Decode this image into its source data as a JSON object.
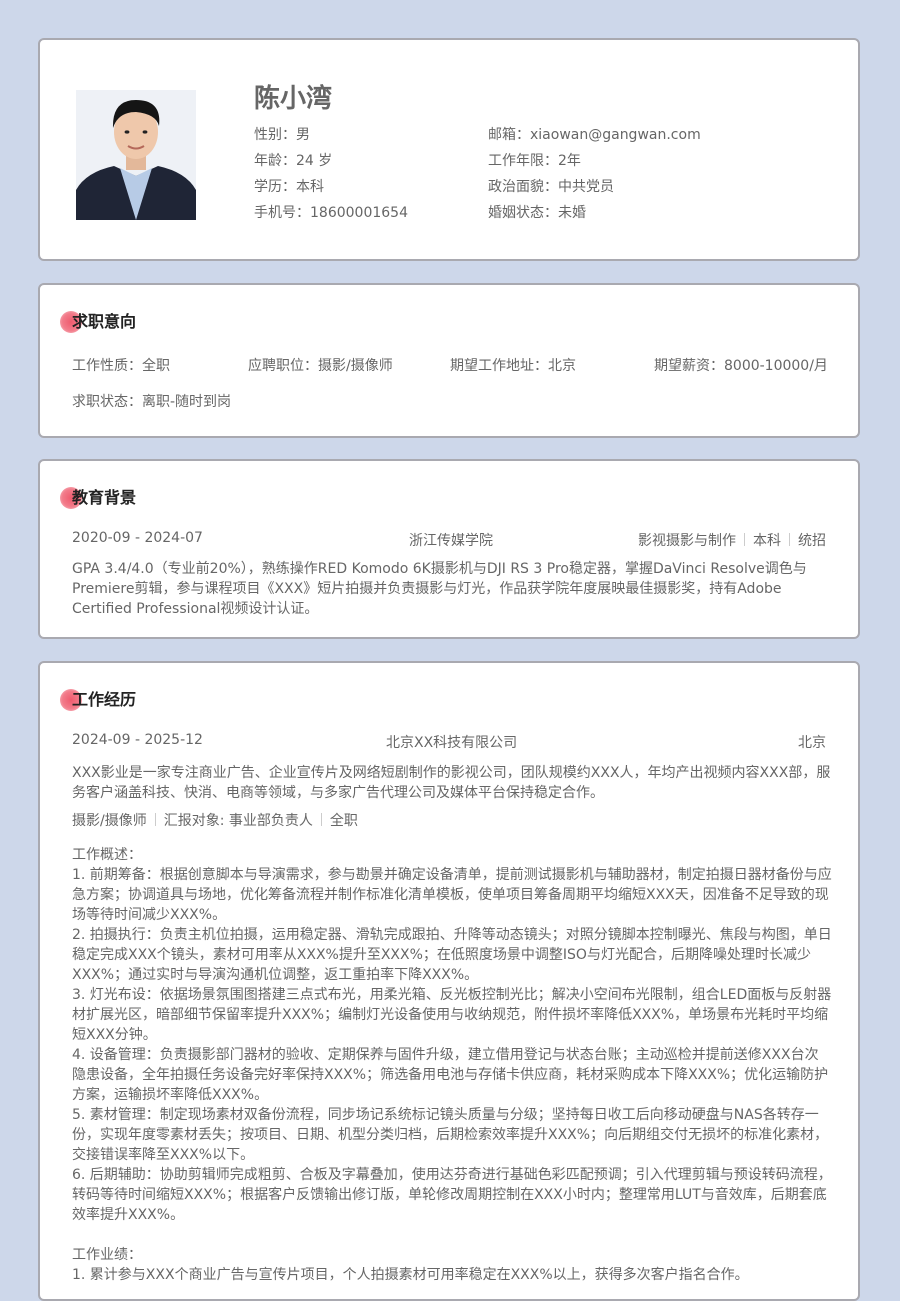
{
  "profile": {
    "name": "陈小湾",
    "gender_label": "性别：",
    "gender": "男",
    "age_label": "年龄：",
    "age": "24 岁",
    "education_label": "学历：",
    "education": "本科",
    "phone_label": "手机号：",
    "phone": "18600001654",
    "email_label": "邮箱：",
    "email": "xiaowan@gangwan.com",
    "years_label": "工作年限：",
    "years": "2年",
    "politics_label": "政治面貌：",
    "politics": "中共党员",
    "marital_label": "婚姻状态：",
    "marital": "未婚"
  },
  "intent": {
    "title": "求职意向",
    "type_label": "工作性质：",
    "type": "全职",
    "position_label": "应聘职位：",
    "position": "摄影/摄像师",
    "location_label": "期望工作地址：",
    "location": "北京",
    "salary_label": "期望薪资：",
    "salary": "8000-10000/月",
    "status_label": "求职状态：",
    "status": "离职-随时到岗"
  },
  "education": {
    "title": "教育背景",
    "period": "2020-09 - 2024-07",
    "school": "浙江传媒学院",
    "major": "影视摄影与制作",
    "degree": "本科",
    "enroll": "统招",
    "description": "GPA 3.4/4.0（专业前20%），熟练操作RED Komodo 6K摄影机与DJI RS 3 Pro稳定器，掌握DaVinci Resolve调色与Premiere剪辑，参与课程项目《XXX》短片拍摄并负责摄影与灯光，作品获学院年度展映最佳摄影奖，持有Adobe Certified Professional视频设计认证。"
  },
  "work": {
    "title": "工作经历",
    "period": "2024-09 - 2025-12",
    "company": "北京XX科技有限公司",
    "city": "北京",
    "company_intro": "XXX影业是一家专注商业广告、企业宣传片及网络短剧制作的影视公司，团队规模约XXX人，年均产出视频内容XXX部，服务客户涵盖科技、快消、电商等领域，与多家广告代理公司及媒体平台保持稳定合作。",
    "role": "摄影/摄像师",
    "report_to": "汇报对象: 事业部负责人",
    "employment": "全职",
    "overview_label": "工作概述：",
    "duties": [
      "1. 前期筹备：根据创意脚本与导演需求，参与勘景并确定设备清单，提前测试摄影机与辅助器材，制定拍摄日器材备份与应急方案；协调道具与场地，优化筹备流程并制作标准化清单模板，使单项目筹备周期平均缩短XXX天，因准备不足导致的现场等待时间减少XXX%。",
      "2. 拍摄执行：负责主机位拍摄，运用稳定器、滑轨完成跟拍、升降等动态镜头；对照分镜脚本控制曝光、焦段与构图，单日稳定完成XXX个镜头，素材可用率从XXX%提升至XXX%；在低照度场景中调整ISO与灯光配合，后期降噪处理时长减少XXX%；通过实时与导演沟通机位调整，返工重拍率下降XXX%。",
      "3. 灯光布设：依据场景氛围图搭建三点式布光，用柔光箱、反光板控制光比；解决小空间布光限制，组合LED面板与反射器材扩展光区，暗部细节保留率提升XXX%；编制灯光设备使用与收纳规范，附件损坏率降低XXX%，单场景布光耗时平均缩短XXX分钟。",
      "4. 设备管理：负责摄影部门器材的验收、定期保养与固件升级，建立借用登记与状态台账；主动巡检并提前送修XXX台次隐患设备，全年拍摄任务设备完好率保持XXX%；筛选备用电池与存储卡供应商，耗材采购成本下降XXX%；优化运输防护方案，运输损坏率降低XXX%。",
      "5. 素材管理：制定现场素材双备份流程，同步场记系统标记镜头质量与分级；坚持每日收工后向移动硬盘与NAS各转存一份，实现年度零素材丢失；按项目、日期、机型分类归档，后期检索效率提升XXX%；向后期组交付无损坏的标准化素材，交接错误率降至XXX%以下。",
      "6. 后期辅助：协助剪辑师完成粗剪、合板及字幕叠加，使用达芬奇进行基础色彩匹配预调；引入代理剪辑与预设转码流程，转码等待时间缩短XXX%；根据客户反馈输出修订版，单轮修改周期控制在XXX小时内；整理常用LUT与音效库，后期套底效率提升XXX%。"
    ],
    "achievement_label": "工作业绩：",
    "achievements": [
      "1. 累计参与XXX个商业广告与宣传片项目，个人拍摄素材可用率稳定在XXX%以上，获得多次客户指名合作。"
    ]
  }
}
